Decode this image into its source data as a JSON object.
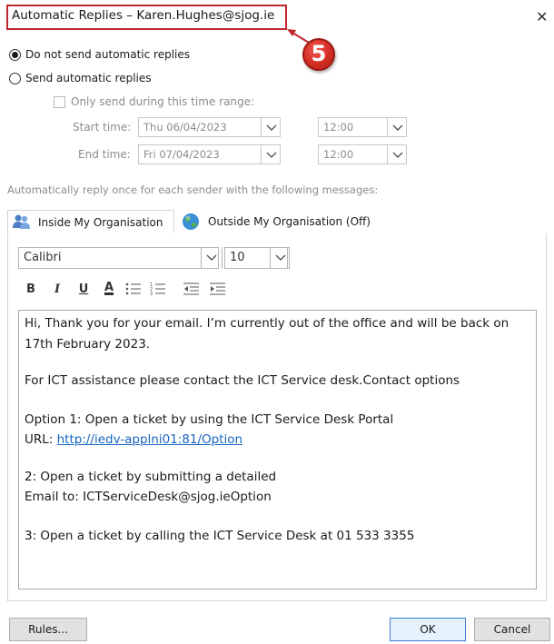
{
  "window": {
    "title": "Automatic Replies – Karen.Hughes@sjog.ie",
    "close_icon": "✕",
    "callout_number": "5",
    "callout_color": "#d32d23"
  },
  "reply_mode": {
    "option_off_label": "Do not send automatic replies",
    "option_on_label": "Send automatic replies",
    "selected": "Do not send automatic replies",
    "time_range_label": "Only send during this time range:",
    "start_label": "Start time:",
    "start_date": "Thu 06/04/2023",
    "start_time": "12:00",
    "end_label": "End time:",
    "end_date": "Fri 07/04/2023",
    "end_time": "12:00"
  },
  "messages_caption": "Automatically reply once for each sender with the following messages:",
  "tabs": [
    {
      "label": "Inside My Organisation",
      "icon": "people-icon",
      "active": true
    },
    {
      "label": "Outside My Organisation (Off)",
      "icon": "globe-icon",
      "active": false
    }
  ],
  "format_toolbar": {
    "font_name": "Calibri",
    "font_size": "10",
    "bold": "B",
    "italic": "I",
    "underline": "U",
    "font_color": "A"
  },
  "message": {
    "line1": "Hi, Thank you for your email. I’m currently out of the office and will be back on",
    "line2": "17th February 2023.",
    "line3": "For ICT assistance please contact the ICT Service desk.Contact options",
    "line4": "Option 1: Open a ticket by using the ICT Service Desk Portal",
    "line5_prefix": "URL: ",
    "line5_link": "http://iedv-applni01:81/Option",
    "line6": "2: Open a ticket by submitting a detailed",
    "line7": "Email to: ICTServiceDesk@sjog.ieOption",
    "line8": "3: Open a ticket by calling the ICT Service Desk at 01 533 3355"
  },
  "buttons": {
    "rules": "Rules...",
    "ok": "OK",
    "cancel": "Cancel"
  }
}
